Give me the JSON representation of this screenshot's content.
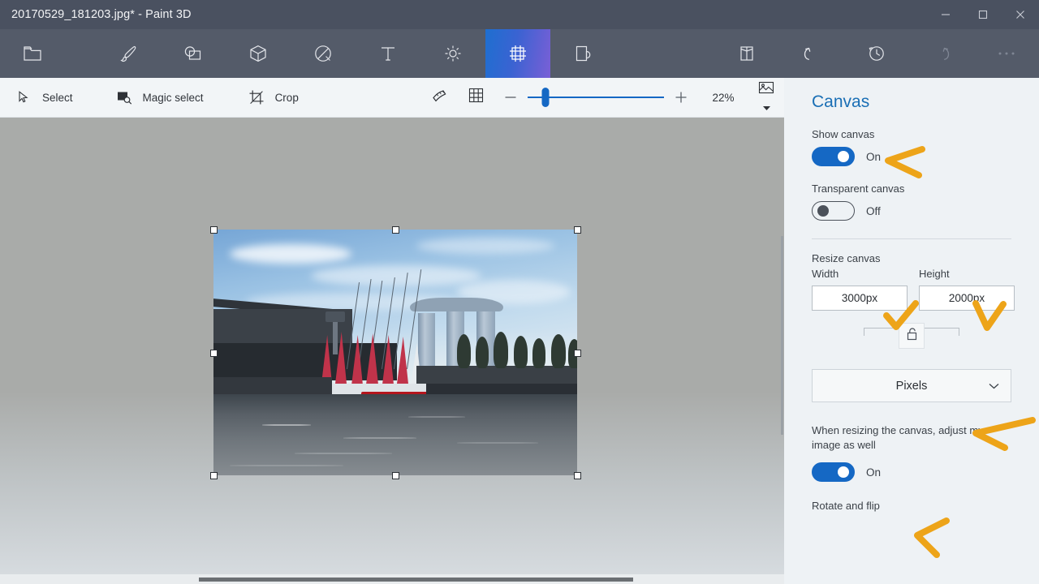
{
  "window": {
    "title": "20170529_181203.jpg* - Paint 3D",
    "minimize_label": "Minimize",
    "maximize_label": "Maximize",
    "close_label": "Close"
  },
  "ribbon": {
    "tabs": [
      {
        "name": "menu",
        "icon": "folder-icon",
        "label": "Menu",
        "active": false
      },
      {
        "name": "brushes",
        "icon": "brush-icon",
        "label": "Brushes",
        "active": false
      },
      {
        "name": "shapes-2d",
        "icon": "2d-shapes-icon",
        "label": "2D shapes",
        "active": false
      },
      {
        "name": "shapes-3d",
        "icon": "3d-shapes-icon",
        "label": "3D shapes",
        "active": false
      },
      {
        "name": "stickers",
        "icon": "stickers-icon",
        "label": "Stickers",
        "active": false
      },
      {
        "name": "text",
        "icon": "text-icon",
        "label": "Text",
        "active": false
      },
      {
        "name": "effects",
        "icon": "effects-sun-icon",
        "label": "Effects",
        "active": false
      },
      {
        "name": "canvas",
        "icon": "canvas-frame-icon",
        "label": "Canvas",
        "active": true
      },
      {
        "name": "3d-library",
        "icon": "3d-library-icon",
        "label": "3D Library",
        "active": false
      },
      {
        "name": "mixed-reality",
        "icon": "mixed-reality-icon",
        "label": "Mixed reality",
        "active": false
      },
      {
        "name": "undo",
        "icon": "undo-icon",
        "label": "Undo",
        "active": false
      },
      {
        "name": "history",
        "icon": "history-icon",
        "label": "History",
        "active": false
      },
      {
        "name": "redo",
        "icon": "redo-icon",
        "label": "Redo",
        "active": false
      },
      {
        "name": "more-options",
        "icon": "ellipsis-icon",
        "label": "More options",
        "active": false
      }
    ]
  },
  "subtoolbar": {
    "select_label": "Select",
    "magic_select_label": "Magic select",
    "crop_label": "Crop",
    "ruler_icon_label": "Ruler",
    "grid_icon_label": "Grid",
    "zoom_out_label": "Zoom out",
    "zoom_in_label": "Zoom in",
    "zoom_percent": "22%",
    "zoom_slider_value": 13,
    "view_options_label": "View options"
  },
  "canvas": {
    "accent_color": "#1568c4",
    "selection_handle_count": 8,
    "image_description": "Marina Bay Sands Singapore waterfront with red-sailed boats"
  },
  "panel": {
    "title": "Canvas",
    "show_canvas": {
      "label": "Show canvas",
      "state": "On"
    },
    "transparent_canvas": {
      "label": "Transparent canvas",
      "state": "Off"
    },
    "resize_canvas": {
      "label": "Resize canvas",
      "width_label": "Width",
      "width_value": "3000px",
      "height_label": "Height",
      "height_value": "2000px",
      "lock_aspect_icon": "unlocked-padlock-icon"
    },
    "units": {
      "selected": "Pixels",
      "chevron_icon": "chevron-down-icon"
    },
    "adjust_image": {
      "label": "When resizing the canvas, adjust my image as well",
      "state": "On"
    },
    "rotate_and_flip_label": "Rotate and flip"
  },
  "annotations": {
    "color": "#eda419",
    "marks": [
      {
        "name": "arrow-show-canvas",
        "shape": "left-arrow"
      },
      {
        "name": "check-width",
        "shape": "checkmark"
      },
      {
        "name": "check-height",
        "shape": "checkmark"
      },
      {
        "name": "arrow-units",
        "shape": "left-arrow"
      },
      {
        "name": "arrow-adjust-image",
        "shape": "left-arrow"
      }
    ]
  }
}
